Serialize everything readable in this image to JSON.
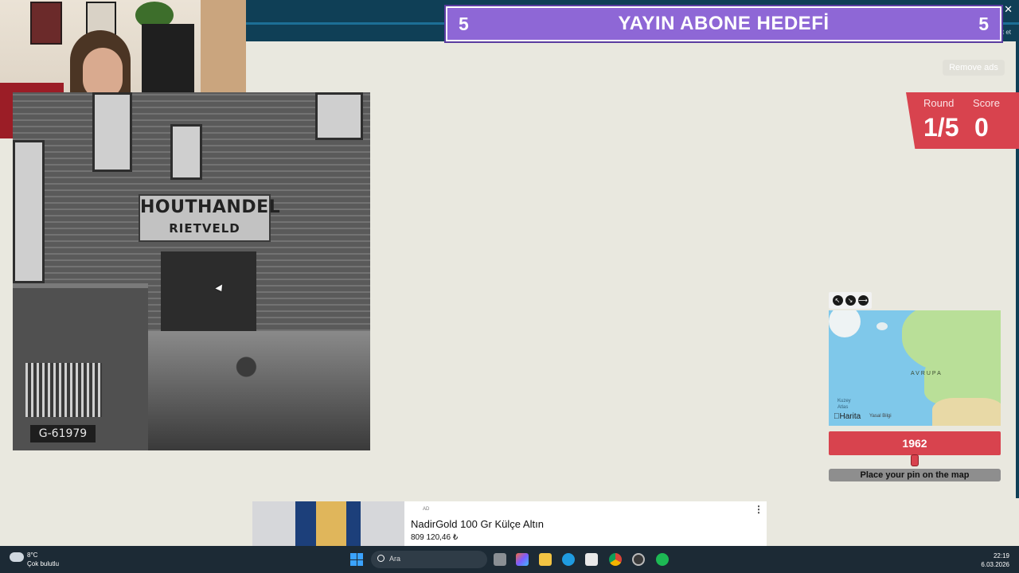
{
  "overlay": {
    "sub_goal_left": "5",
    "sub_goal_title": "YAYIN ABONE HEDEFİ",
    "sub_goal_right": "5"
  },
  "browser": {
    "close_glyph": "✕",
    "corner_text": "oct et"
  },
  "game": {
    "remove_ads_label": "Remove ads",
    "round_label": "Round",
    "round_value": "1/5",
    "score_label": "Score",
    "score_value": "0",
    "photo": {
      "sign_line1": "HOUTHANDEL",
      "sign_line2": "RIETVELD",
      "plate": "G-61979"
    },
    "map": {
      "region_label": "AVRUPA",
      "ocean_label_1": "Kuzey",
      "ocean_label_2": "Atlas",
      "brand": "Harita",
      "legal": "Yasal Bilgi",
      "controls": [
        "expand-icon",
        "shrink-icon",
        "pin-icon"
      ]
    },
    "year": {
      "value": "1962",
      "position_fraction": 0.5
    },
    "place_pin_label": "Place your pin on the map",
    "accent_color": "#d8434e"
  },
  "ad": {
    "tag": "AD",
    "title": "NadirGold 100 Gr Külçe Altın",
    "price": "809 120,46 ₺",
    "more_glyph": "⋮"
  },
  "taskbar": {
    "weather_temp": "8°C",
    "weather_desc": "Çok bulutlu",
    "search_placeholder": "Ara",
    "time": "22:19",
    "date": "6.03.2026"
  }
}
